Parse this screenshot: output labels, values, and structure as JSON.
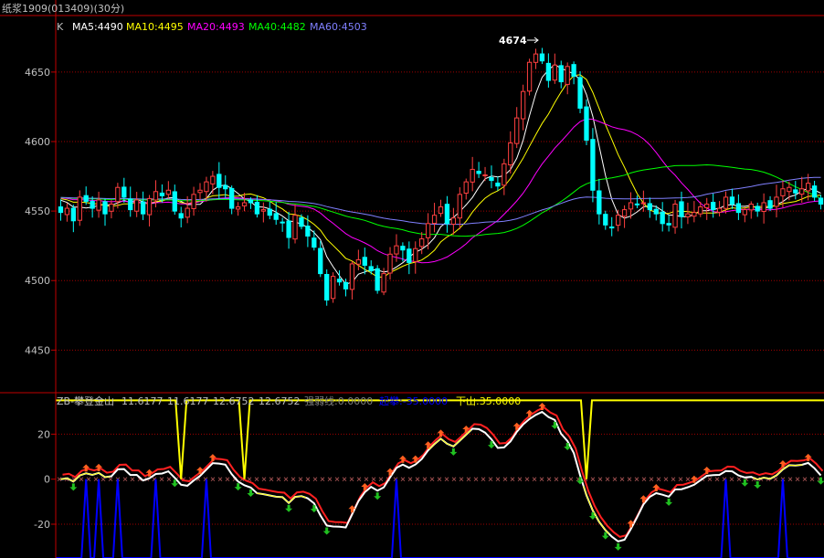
{
  "title": "纸浆1909(013409)(30分)",
  "main_panel": {
    "label": "K",
    "ma_legend": [
      {
        "text": "MA5:4490",
        "color": "#ffffff"
      },
      {
        "text": "MA10:4495",
        "color": "#ffff00"
      },
      {
        "text": "MA20:4493",
        "color": "#ff00ff"
      },
      {
        "text": "MA40:4482",
        "color": "#00ff00"
      },
      {
        "text": "MA60:4503",
        "color": "#8080ff"
      }
    ],
    "annotation": "4674",
    "colors": {
      "up": "#ff4040",
      "down": "#00ffff"
    }
  },
  "sub_panel": {
    "label": "ZB-攀登金山",
    "values": [
      {
        "text": "11.6177",
        "color": "#c0c0c0"
      },
      {
        "text": "11.6177",
        "color": "#c0c0c0"
      },
      {
        "text": "12.6752",
        "color": "#c0c0c0"
      },
      {
        "text": "12.6752",
        "color": "#c0c0c0"
      },
      {
        "text": "强弱线:0.0000",
        "color": "#808080"
      },
      {
        "text": "起攀:-35.0000",
        "color": "#0000ff"
      },
      {
        "text": "下山:35.0000",
        "color": "#ffff00"
      }
    ]
  },
  "chart_data": [
    {
      "type": "candlestick",
      "y_ticks": [
        "4650",
        "4600",
        "4550",
        "4500",
        "4450"
      ],
      "ylim": [
        4420,
        4690
      ],
      "high_marker": 4674,
      "last_values": {
        "MA5": 4490,
        "MA10": 4495,
        "MA20": 4493,
        "MA40": 4482,
        "MA60": 4503
      },
      "close": [
        4549,
        4552,
        4543,
        4560,
        4557,
        4552,
        4558,
        4548,
        4555,
        4567,
        4560,
        4551,
        4558,
        4548,
        4559,
        4564,
        4561,
        4565,
        4550,
        4545,
        4552,
        4562,
        4565,
        4571,
        4575,
        4567,
        4566,
        4552,
        4553,
        4556,
        4556,
        4548,
        4551,
        4547,
        4544,
        4542,
        4531,
        4547,
        4539,
        4532,
        4524,
        4505,
        4486,
        4503,
        4499,
        4494,
        4512,
        4515,
        4511,
        4507,
        4493,
        4505,
        4519,
        4525,
        4522,
        4513,
        4523,
        4530,
        4541,
        4547,
        4553,
        4541,
        4545,
        4562,
        4571,
        4580,
        4577,
        4576,
        4572,
        4568,
        4584,
        4599,
        4617,
        4636,
        4657,
        4663,
        4658,
        4644,
        4655,
        4643,
        4654,
        4647,
        4624,
        4601,
        4565,
        4548,
        4540,
        4538,
        4547,
        4551,
        4556,
        4555,
        4556,
        4551,
        4548,
        4541,
        4540,
        4555,
        4546,
        4548,
        4549,
        4553,
        4555,
        4551,
        4552,
        4560,
        4555,
        4549,
        4551,
        4555,
        4550,
        4556,
        4552,
        4560,
        4566,
        4567,
        4563,
        4566,
        4570,
        4560,
        4555
      ],
      "ma_lines": [
        "MA5",
        "MA10",
        "MA20",
        "MA40",
        "MA60"
      ]
    },
    {
      "type": "line",
      "y_ticks": [
        "20",
        "0",
        "-20"
      ],
      "ylim": [
        -35,
        38
      ],
      "series": [
        {
          "name": "强弱线",
          "values": [
            0
          ]
        },
        {
          "name": "起攀",
          "values": [
            -35
          ]
        },
        {
          "name": "下山",
          "values": [
            35
          ]
        }
      ]
    }
  ]
}
